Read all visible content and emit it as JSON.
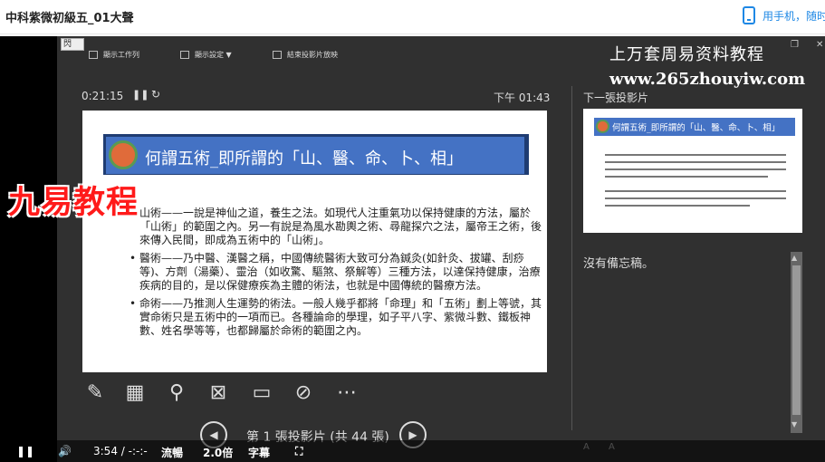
{
  "page": {
    "course_title": "中科紫微初級五_01大聲",
    "phone_link": "用手机，随时随地学"
  },
  "player_top": {
    "small_icon_text": "閃",
    "toolbar": [
      {
        "label": "顯示工作列"
      },
      {
        "label": "顯示設定 ▼"
      },
      {
        "label": "結束投影片放映"
      }
    ],
    "watermark_cn": "上万套周易资料教程",
    "watermark_url": "www.265zhouyiw.com"
  },
  "presenter": {
    "timer": "0:21:15",
    "pause_glyph": "❚❚",
    "reset_glyph": "↻",
    "clock": "下午 01:43",
    "current_slide": {
      "title": "何謂五術_即所謂的「山、醫、命、卜、相」",
      "bullets": [
        "山術——一說是神仙之道，養生之法。如現代人注重氣功以保持健康的方法，屬於「山術」的範圍之內。另一有說是為風水勘輿之術、尋龍探穴之法，屬帝王之術，後來傳入民間，即成為五術中的「山術」。",
        "醫術——乃中醫、漢醫之稱，中國傳統醫術大致可分為鍼灸(如針灸、拔罐、刮痧等)、方劑（湯藥）、靈治（如收驚、驅煞、祭解等）三種方法，以達保持健康，治療疾病的目的，是以保健療疾為主體的術法，也就是中國傳統的醫療方法。",
        "命術——乃推測人生運勢的術法。一般人幾乎都將「命理」和「五術」劃上等號，其實命術只是五術中的一項而已。各種論命的學理，如子平八字、紫微斗數、鐵板神數、姓名學等等，也都歸屬於命術的範圍之內。"
      ]
    },
    "jiuyi_watermark": "九易教程",
    "slide_count": "第 1 張投影片 (共 44 張)",
    "next_label": "下一張投影片",
    "next_slide_title": "何謂五術_即所謂的「山、醫、命、卜、相」",
    "notes": "沒有備忘稿。",
    "font_up": "A",
    "font_down": "A"
  },
  "controls": {
    "time": "3:54 / -:-:-",
    "quality": "流暢",
    "speed": "2.0倍",
    "subtitle": "字幕"
  }
}
